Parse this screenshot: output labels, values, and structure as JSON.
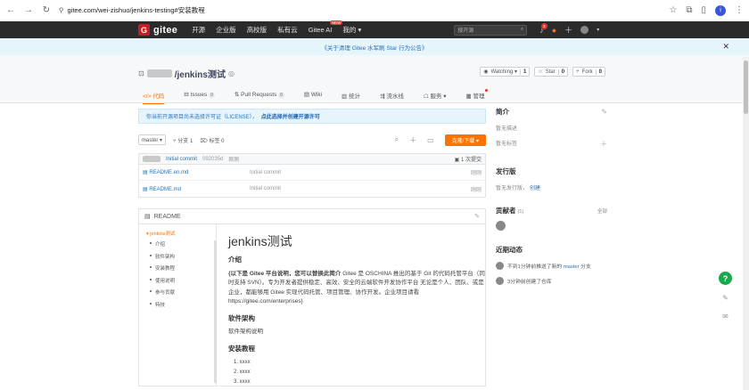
{
  "browser": {
    "url": "gitee.com/wei-zishuo/jenkins-testing#安装教程",
    "profile_initial": "i"
  },
  "topnav": {
    "logo": "gitee",
    "items": [
      "开源",
      "企业版",
      "高校版",
      "私有云",
      "Gitee AI",
      "我的 ▾"
    ],
    "new_badge": "NEW",
    "search_placeholder": "搜开源",
    "notif_count": "3"
  },
  "announcement": {
    "text": "《关于清理 Gitee 水军刷 Star 行为公告》"
  },
  "repo": {
    "name": "/jenkins测试",
    "watching": {
      "label": "Watching ▾",
      "count": "1"
    },
    "star": {
      "label": "Star",
      "count": "0"
    },
    "fork": {
      "label": "Fork",
      "count": "0"
    },
    "tabs": [
      {
        "label": "代码",
        "count": ""
      },
      {
        "label": "Issues",
        "count": "0"
      },
      {
        "label": "Pull Requests",
        "count": "0"
      },
      {
        "label": "Wiki",
        "count": ""
      },
      {
        "label": "统计",
        "count": ""
      },
      {
        "label": "流水线",
        "count": ""
      },
      {
        "label": "服务 ▾",
        "count": ""
      },
      {
        "label": "管理",
        "count": ""
      }
    ]
  },
  "license_notice": {
    "text": "你当前开源项目尚未选择许可证（LICENSE），",
    "link": "点此选择并创建开源许可"
  },
  "toolbar": {
    "branch": "master ▾",
    "branches": "分支 1",
    "tags": "标签 0",
    "clone_button": "克隆/下载 ▾"
  },
  "files": {
    "commit": {
      "message": "Initial commit",
      "hash": "092035d",
      "time": "刚刚",
      "total": "1 次提交"
    },
    "rows": [
      {
        "name": "README.en.md",
        "message": "Initial commit",
        "time": "刚刚"
      },
      {
        "name": "README.md",
        "message": "Initial commit",
        "time": "刚刚"
      }
    ]
  },
  "readme": {
    "header": "README",
    "toc": [
      "jenkins测试",
      "介绍",
      "软件架构",
      "安装教程",
      "使用说明",
      "参与贡献",
      "特技"
    ],
    "title": "jenkins测试",
    "intro_heading": "介绍",
    "intro_bold": "{以下是 Gitee 平台说明，您可以替换此简介",
    "intro_text": " Gitee 是 OSCHINA 推出的基于 Git 的代码托管平台（同时支持 SVN）。专为开发者提供稳定、高效、安全的云端软件开发协作平台 无论是个人、团队、或是企业，都能够用 Gitee 实现代码托管、项目管理、协作开发。企业项目请看 https://gitee.com/enterprises}",
    "arch_heading": "软件架构",
    "arch_text": "软件架构说明",
    "install_heading": "安装教程",
    "install_steps": [
      "1.  xxxx",
      "2.  xxxx",
      "3.  xxxx"
    ]
  },
  "sidebar": {
    "intro_title": "简介",
    "no_desc": "暂无描述",
    "no_tags": "暂无标签",
    "release_title": "发行版",
    "no_release": "暂无发行版，",
    "create": "创建",
    "contrib_title": "贡献者",
    "contrib_count": "(1)",
    "all": "全部",
    "activity_title": "近期动态",
    "activity": [
      {
        "pre": "不到1分钟前推送了新的 ",
        "link": "master",
        "post": " 分支"
      },
      {
        "pre": "3分钟前创建了仓库",
        "link": "",
        "post": ""
      }
    ]
  },
  "float": {
    "help": "?"
  }
}
